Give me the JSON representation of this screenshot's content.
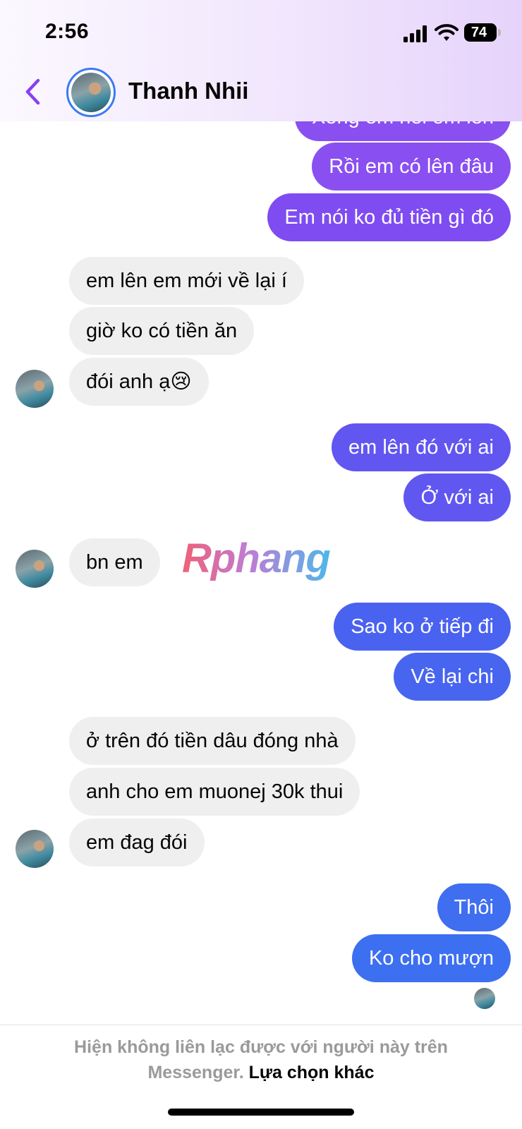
{
  "status_bar": {
    "time": "2:56",
    "battery": "74"
  },
  "header": {
    "contact_name": "Thanh Nhii"
  },
  "messages": [
    {
      "from": "me",
      "text": "Xong em nói em lên",
      "color": "#8a4ff0"
    },
    {
      "from": "me",
      "text": "Rồi em có lên đâu",
      "color": "#8a4ff0"
    },
    {
      "from": "me",
      "text": "Em nói ko đủ tiền gì đó",
      "color": "#7f4cf1"
    },
    {
      "from": "them",
      "text": "em lên em mới về lại í"
    },
    {
      "from": "them",
      "text": "giờ ko có tiền ăn"
    },
    {
      "from": "them",
      "text": "đói anh ạ😢"
    },
    {
      "from": "me",
      "text": "em lên đó với ai",
      "color": "#6256f1"
    },
    {
      "from": "me",
      "text": "Ở với ai",
      "color": "#6057f1"
    },
    {
      "from": "them",
      "text": "bn em"
    },
    {
      "from": "me",
      "text": "Sao ko ở tiếp đi",
      "color": "#4a62f0"
    },
    {
      "from": "me",
      "text": "Về lại chi",
      "color": "#4865f0"
    },
    {
      "from": "them",
      "text": "ở trên đó tiền dâu đóng nhà"
    },
    {
      "from": "them",
      "text": "anh cho em muonej 30k thui"
    },
    {
      "from": "them",
      "text": "em đag đói"
    },
    {
      "from": "me",
      "text": "Thôi",
      "color": "#3f6ef1"
    },
    {
      "from": "me",
      "text": "Ko cho mượn",
      "color": "#3d6ff1"
    }
  ],
  "watermark": "Rphang",
  "footer": {
    "notice": "Hiện không liên lạc được với người này trên Messenger.",
    "link": "Lựa chọn khác"
  },
  "icons": {
    "back": "chevron-left-icon",
    "signal": "signal-icon",
    "wifi": "wifi-icon",
    "battery": "battery-icon"
  },
  "colors": {
    "accent": "#8a4ff0",
    "incoming_bubble": "#efefef",
    "back_icon": "#8a3ff0"
  }
}
